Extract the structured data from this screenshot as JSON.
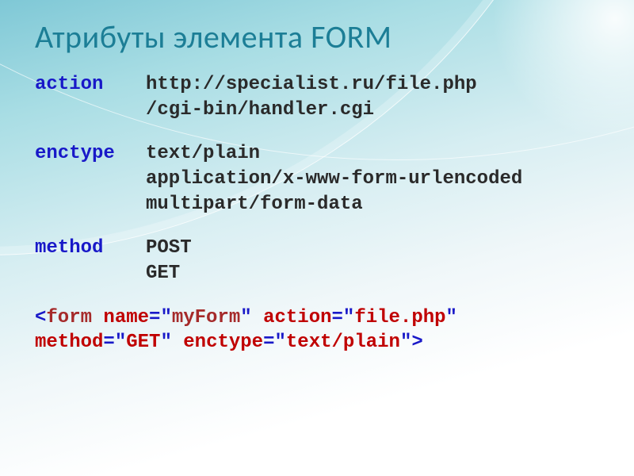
{
  "title": "Атрибуты элемента FORM",
  "attrs": [
    {
      "label": "action",
      "values": [
        "http://specialist.ru/file.php",
        "/cgi-bin/handler.cgi"
      ]
    },
    {
      "label": "enctype",
      "values": [
        "text/plain",
        "application/x-www-form-urlencoded",
        "multipart/form-data"
      ]
    },
    {
      "label": "method",
      "values": [
        "POST",
        "GET"
      ]
    }
  ],
  "code": {
    "lt": "<",
    "gt": ">",
    "eq": "=",
    "q": "\"",
    "sp": " ",
    "tag": "form",
    "attr_name": "name",
    "val_name": "myForm",
    "attr_action": "action",
    "val_action": "file.php",
    "attr_method": "method",
    "val_method": "GET",
    "attr_enctype": "enctype",
    "val_enctype": "text/plain"
  }
}
